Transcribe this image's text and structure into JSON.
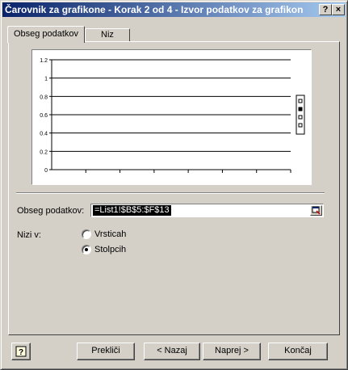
{
  "window": {
    "title": "Čarovnik za grafikone - Korak 2 od 4 - Izvor podatkov za grafikon",
    "help_button": "?",
    "close_button": "×"
  },
  "tabs": [
    {
      "label": "Obseg podatkov",
      "active": true
    },
    {
      "label": "Niz",
      "active": false
    }
  ],
  "chart_data": {
    "type": "line",
    "y_ticks": [
      "1.2",
      "1",
      "0.8",
      "0.6",
      "0.4",
      "0.2",
      "0"
    ],
    "ylim": [
      0,
      1.2
    ],
    "grid": true,
    "legend_placement": "right",
    "legend_entries": 4,
    "categories": 7
  },
  "data_range": {
    "label": "Obseg podatkov:",
    "value": "=List1!$B$5:$F$13"
  },
  "series_in": {
    "label": "Nizi v:",
    "options": [
      {
        "label": "Vrsticah",
        "selected": false
      },
      {
        "label": "Stolpcih",
        "selected": true
      }
    ]
  },
  "buttons": {
    "cancel": "Prekliči",
    "back": "< Nazaj",
    "next": "Naprej >",
    "finish": "Končaj"
  }
}
